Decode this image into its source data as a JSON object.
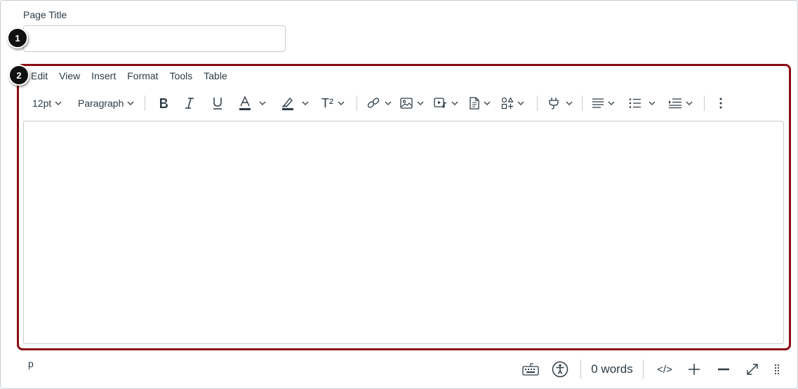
{
  "page_title": {
    "label": "Page Title",
    "value": "",
    "placeholder": ""
  },
  "callouts": [
    "1",
    "2"
  ],
  "menubar": [
    "Edit",
    "View",
    "Insert",
    "Format",
    "Tools",
    "Table"
  ],
  "toolbar": {
    "font_size": "12pt",
    "block_format": "Paragraph",
    "superscript_label": "T²",
    "icons": [
      "bold-icon",
      "italic-icon",
      "underline-icon",
      "text-color-icon",
      "highlight-icon",
      "superscript-icon",
      "link-icon",
      "image-icon",
      "media-icon",
      "document-icon",
      "apps-icon",
      "plugin-icon",
      "align-icon",
      "bullet-list-icon",
      "indent-icon",
      "more-icon"
    ]
  },
  "editor": {
    "content": ""
  },
  "status": {
    "path": "p",
    "word_count": "0 words",
    "html_toggle": "</>"
  },
  "colors": {
    "highlight_border": "#8b0c12",
    "text": "#2d3b45",
    "border": "#c7cdd1",
    "callout_bg": "#111111"
  }
}
